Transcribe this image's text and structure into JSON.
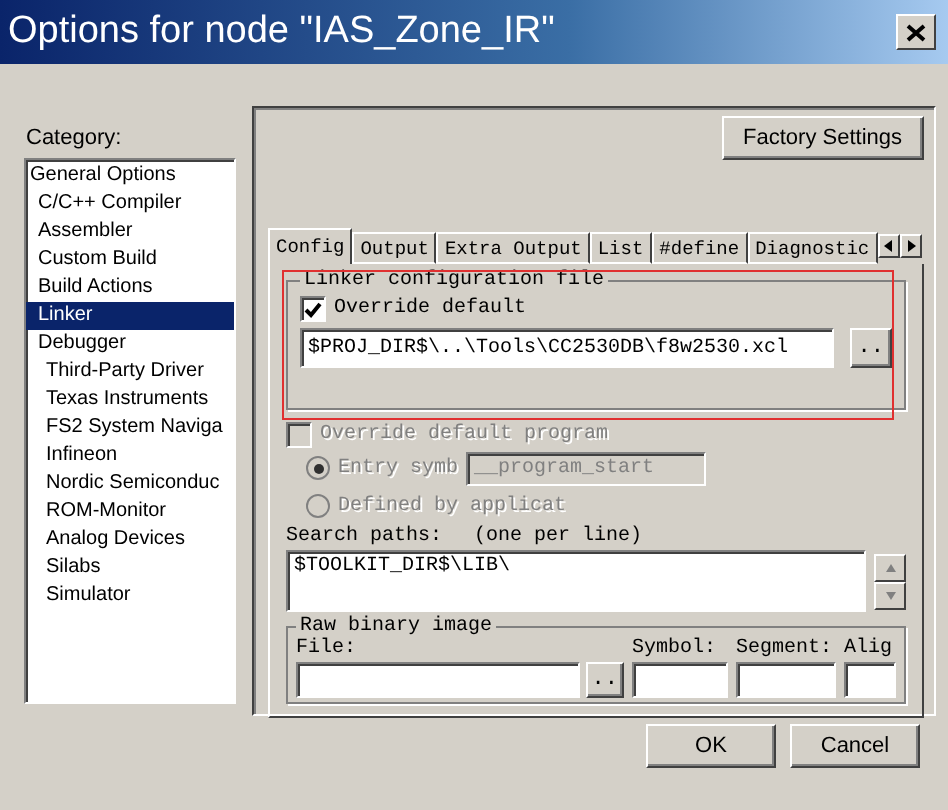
{
  "window": {
    "title": "Options for node \"IAS_Zone_IR\""
  },
  "category": {
    "label": "Category:",
    "items": [
      {
        "label": "General Options",
        "selected": false,
        "children": [
          {
            "label": "C/C++ Compiler",
            "selected": false
          },
          {
            "label": "Assembler",
            "selected": false
          },
          {
            "label": "Custom Build",
            "selected": false
          },
          {
            "label": "Build Actions",
            "selected": false
          },
          {
            "label": "Linker",
            "selected": true
          },
          {
            "label": "Debugger",
            "selected": false,
            "children": [
              {
                "label": "Third-Party Driver",
                "selected": false
              },
              {
                "label": "Texas Instruments",
                "selected": false
              },
              {
                "label": "FS2 System Naviga",
                "selected": false
              },
              {
                "label": "Infineon",
                "selected": false
              },
              {
                "label": "Nordic Semiconduc",
                "selected": false
              },
              {
                "label": "ROM-Monitor",
                "selected": false
              },
              {
                "label": "Analog Devices",
                "selected": false
              },
              {
                "label": "Silabs",
                "selected": false
              },
              {
                "label": "Simulator",
                "selected": false
              }
            ]
          }
        ]
      }
    ]
  },
  "factory_button": "Factory Settings",
  "tabs": [
    {
      "label": "Config",
      "selected": true
    },
    {
      "label": "Output",
      "selected": false
    },
    {
      "label": "Extra Output",
      "selected": false
    },
    {
      "label": "List",
      "selected": false
    },
    {
      "label": "#define",
      "selected": false
    },
    {
      "label": "Diagnostic",
      "selected": false
    }
  ],
  "linker_config": {
    "title": "Linker configuration file",
    "override": {
      "label": "Override default",
      "checked": true
    },
    "path": "$PROJ_DIR$\\..\\Tools\\CC2530DB\\f8w2530.xcl",
    "browse": ".."
  },
  "program": {
    "override": {
      "label": "Override default program",
      "checked": false,
      "disabled": true
    },
    "options": [
      {
        "label": "Entry symb",
        "selected": true,
        "disabled": true,
        "value": "__program_start"
      },
      {
        "label": "Defined by applicat",
        "selected": false,
        "disabled": true
      }
    ]
  },
  "search_paths": {
    "label": "Search paths:",
    "hint": "(one per line)",
    "value": "$TOOLKIT_DIR$\\LIB\\"
  },
  "raw_binary": {
    "title": "Raw binary image",
    "fields": [
      {
        "label": "File:",
        "browse": ".."
      },
      {
        "label": "Symbol:"
      },
      {
        "label": "Segment:"
      },
      {
        "label": "Alig"
      }
    ]
  },
  "buttons": [
    {
      "label": "OK"
    },
    {
      "label": "Cancel"
    }
  ]
}
